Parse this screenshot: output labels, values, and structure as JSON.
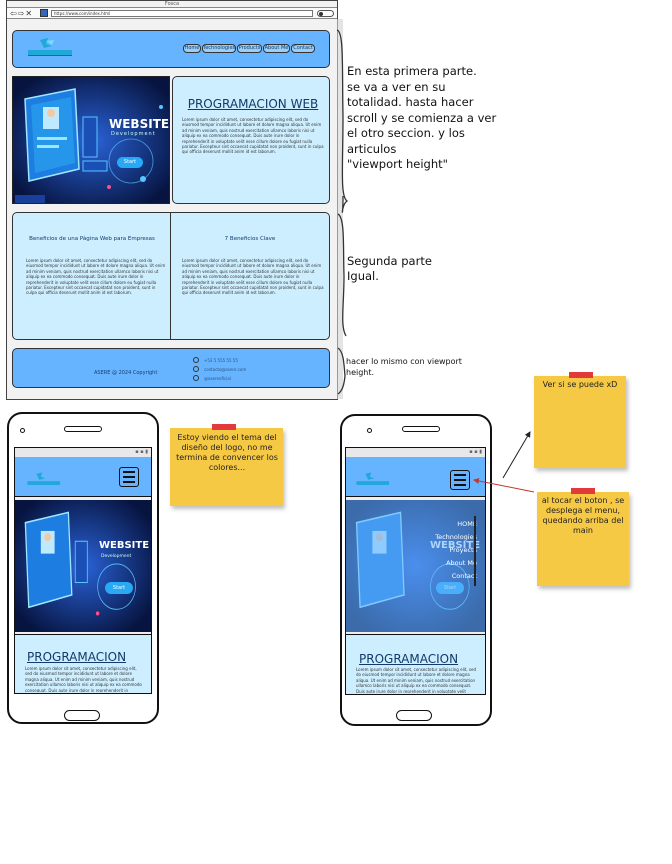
{
  "browser": {
    "window_title": "Fosca",
    "nav_glyphs": "⇦⇨✕",
    "url": "https://www.com/index.html"
  },
  "site": {
    "nav": [
      "Home",
      "Technologies",
      "Products",
      "About Me",
      "Contact"
    ],
    "hero_banner_title": "WEBSITE",
    "hero_banner_sub": "Development",
    "hero_banner_button": "Start",
    "main_title": "PROGRAMACION WEB",
    "lorem": "Lorem ipsum dolor sit amet, consectetur adipiscing elit, sed do eiusmod tempor incididunt ut labore et dolore magna aliqua. Ut enim ad minim veniam, quis nostrud exercitation ullamco laboris nisi ut aliquip ex ea commodo consequat. Duis aute irure dolor in reprehenderit in voluptate velit esse cillum dolore eu fugiat nulla pariatur. Excepteur sint occaecat cupidatat non proident, sunt in culpa qui officia deserunt mollit anim id est laborum.",
    "article1_title": "Beneficios de una Página Web para Empresas",
    "article2_title": "7 Beneficios Clave",
    "copyright": "ASERE @ 2024 Copyright",
    "contacts": [
      "+53 5 555 55 55",
      "contacto@asere.com",
      "@asereoficial"
    ]
  },
  "annotations": {
    "part1": "En esta primera parte.\nse va a ver en su\ntotalidad. hasta hacer\nscroll y se comienza a ver\nel otro seccion. y los\narticulos\n\"viewport height\"",
    "part2": "Segunda parte\nIgual.",
    "part3": "hacer lo mismo con viewport\nheight."
  },
  "stickies": {
    "logo_note": "Estoy viendo el tema del diseño del logo, no me termina de convencer los colores...",
    "see_note": "Ver si se puede xD",
    "menu_note": "al tocar el boton , se desplega el menu, quedando arriba del main"
  },
  "mobile": {
    "title": "PROGRAMACION",
    "menu_items": [
      "HOME",
      "Technologies",
      "Proyects",
      "About Me",
      "Contact"
    ]
  },
  "colors": {
    "header_blue": "#66b3ff",
    "panel_light": "#cdeeff",
    "hero_dark": "#0a1c56",
    "sticky_yellow": "#f6c945",
    "tape_red": "#e23a3a"
  }
}
